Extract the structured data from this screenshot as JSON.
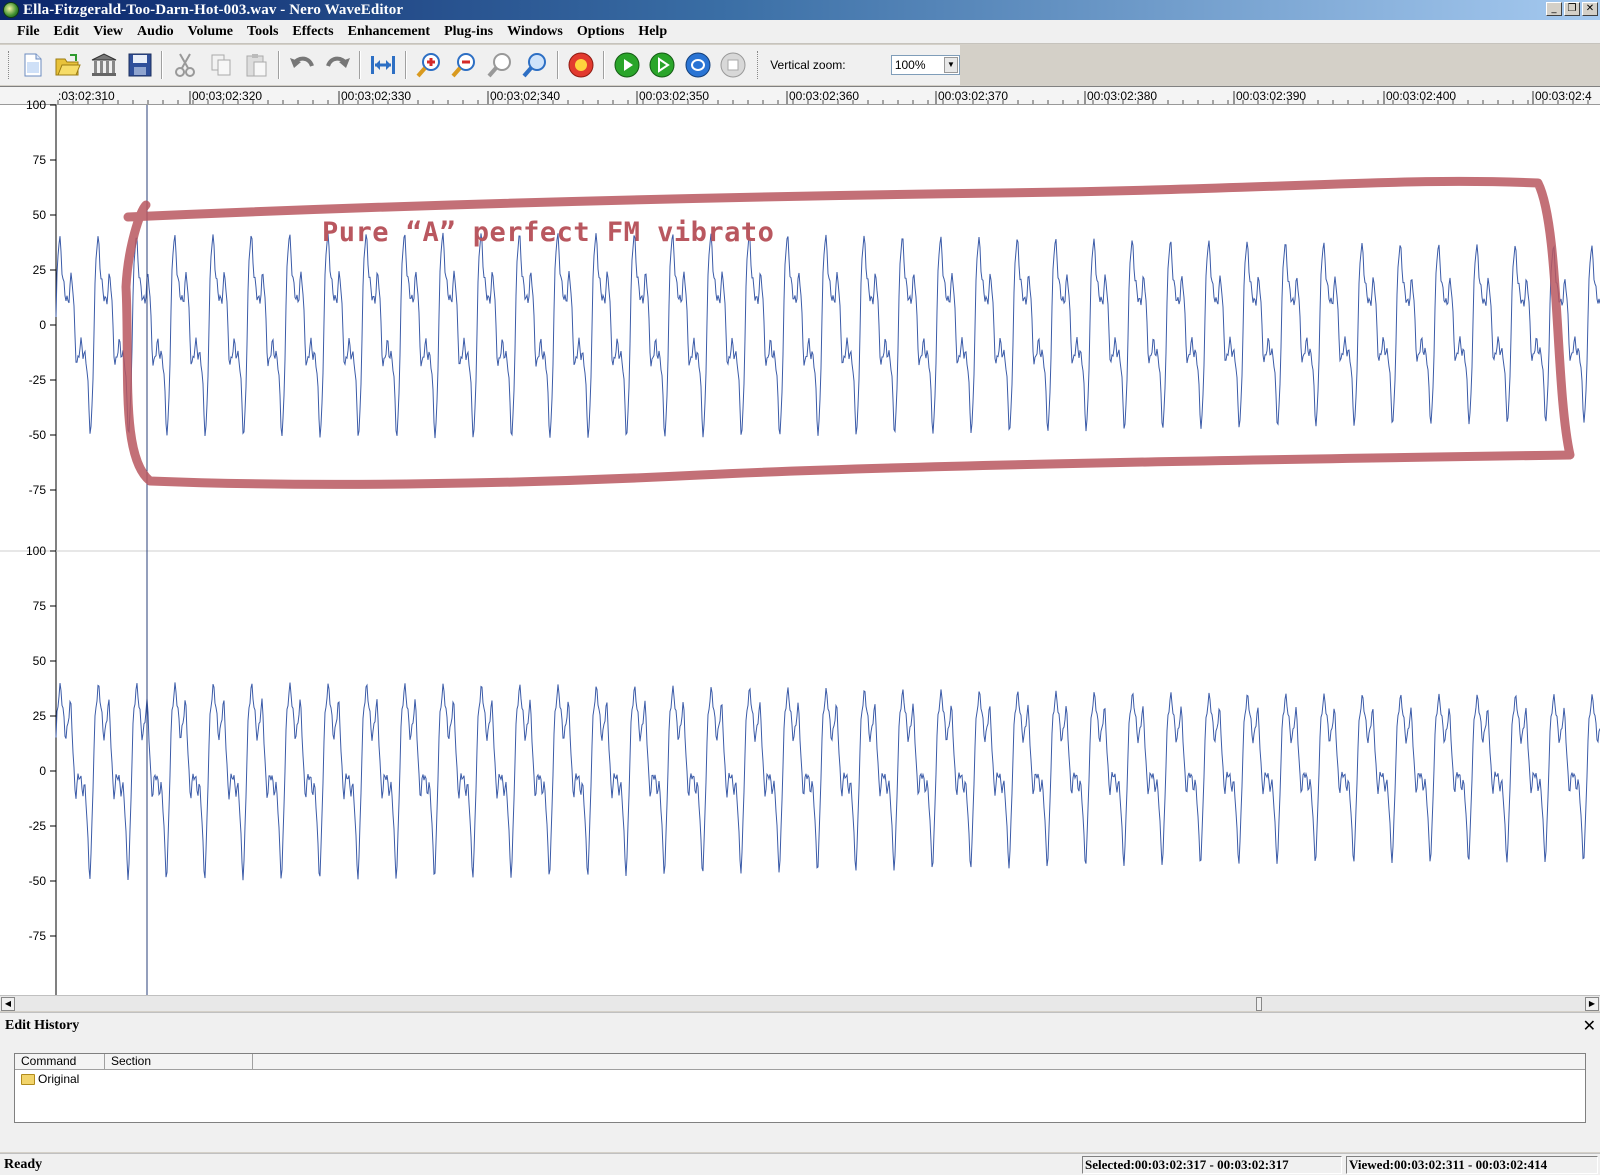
{
  "window": {
    "title": "Ella-Fitzgerald-Too-Darn-Hot-003.wav - Nero WaveEditor",
    "controls": [
      "minimize",
      "restore",
      "close"
    ]
  },
  "menu": [
    "File",
    "Edit",
    "View",
    "Audio",
    "Volume",
    "Tools",
    "Effects",
    "Enhancement",
    "Plug-ins",
    "Windows",
    "Options",
    "Help"
  ],
  "toolbar": {
    "buttons": [
      {
        "name": "new-icon"
      },
      {
        "name": "open-icon"
      },
      {
        "name": "library-icon"
      },
      {
        "name": "save-icon"
      },
      {
        "name": "cut-icon"
      },
      {
        "name": "copy-icon"
      },
      {
        "name": "paste-icon"
      },
      {
        "name": "undo-icon"
      },
      {
        "name": "redo-icon"
      },
      {
        "name": "fit-width-icon"
      },
      {
        "name": "zoom-in-icon"
      },
      {
        "name": "zoom-out-icon"
      },
      {
        "name": "zoom-selection-icon"
      },
      {
        "name": "zoom-full-icon"
      },
      {
        "name": "record-icon"
      },
      {
        "name": "play-icon"
      },
      {
        "name": "play-selection-icon"
      },
      {
        "name": "loop-icon"
      },
      {
        "name": "stop-icon"
      }
    ],
    "vertical_zoom_label": "Vertical zoom:",
    "vertical_zoom_value": "100%"
  },
  "ruler": {
    "labels": [
      ":03:02:310",
      "00:03:02:320",
      "00:03:02:330",
      "00:03:02:340",
      "00:03:02:350",
      "00:03:02:360",
      "00:03:02:370",
      "00:03:02:380",
      "00:03:02:390",
      "00:03:02:400",
      "00:03:02:4"
    ]
  },
  "channels": [
    {
      "id": "top",
      "y_ticks": [
        "100",
        "75",
        "50",
        "25",
        "0",
        "-25",
        "-50",
        "-75"
      ]
    },
    {
      "id": "bottom",
      "y_ticks": [
        "100",
        "75",
        "50",
        "25",
        "0",
        "-25",
        "-50",
        "-75"
      ]
    }
  ],
  "annotation": {
    "text": "Pure “A” perfect FM vibrato",
    "color": "#b9575f"
  },
  "colors": {
    "waveform": "#3b5ba8",
    "annotation": "#b9575f"
  },
  "history": {
    "title": "Edit History",
    "columns": [
      "Command",
      "Section"
    ],
    "rows": [
      {
        "command": "Original",
        "section": ""
      }
    ]
  },
  "status": {
    "ready": "Ready",
    "selected": "Selected:00:03:02:317 - 00:03:02:317",
    "viewed": "Viewed:00:03:02:311 - 00:03:02:414"
  }
}
